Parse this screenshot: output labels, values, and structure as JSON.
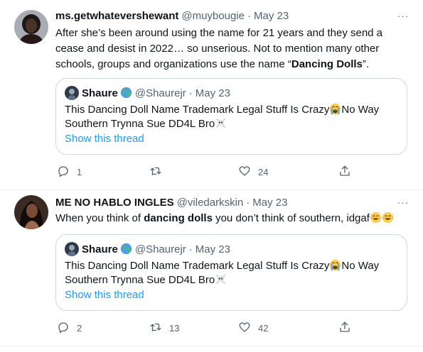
{
  "tweets": [
    {
      "name": "ms.getwhatevershewant",
      "handle": "@muybougie",
      "separator": "·",
      "date": "May 23",
      "more": "···",
      "text_part1": "After she’s been around using the name for 21 years and they send a cease and desist in 2022… so unserious. Not to mention many other schools, groups and organizations use the name “",
      "text_bold": "Dancing Dolls",
      "text_part2": "”.",
      "quote": {
        "name": "Shaure",
        "handle": "@Shaurejr",
        "separator": "·",
        "date": "May 23",
        "line1": "This Dancing Doll Name Trademark Legal Stuff Is Crazy",
        "line1_after": "No Way",
        "line2": "Southern Trynna Sue DD4L Bro",
        "link": "Show this thread"
      },
      "actions": {
        "reply": "1",
        "retweet": "",
        "like": "24"
      }
    },
    {
      "name": "ME NO HABLO INGLES",
      "handle": "@viledarkskin",
      "separator": "·",
      "date": "May 23",
      "more": "···",
      "text_part1": "When you think of ",
      "text_bold": "dancing dolls",
      "text_part2": " you don’t think of southern, idgaf",
      "quote": {
        "name": "Shaure",
        "handle": "@Shaurejr",
        "separator": "·",
        "date": "May 23",
        "line1": "This Dancing Doll Name Trademark Legal Stuff Is Crazy",
        "line1_after": "No Way",
        "line2": "Southern Trynna Sue DD4L Bro",
        "link": "Show this thread"
      },
      "actions": {
        "reply": "2",
        "retweet": "13",
        "like": "42"
      }
    }
  ],
  "colors": {
    "accent": "#1d9bf0",
    "secondary_text": "#536471",
    "border": "#cfd9de"
  },
  "icons": [
    "reply-icon",
    "retweet-icon",
    "like-icon",
    "share-icon",
    "crying-face-emoji",
    "skull-crossbones-emoji",
    "tears-of-joy-emoji",
    "earth-globe-emoji"
  ]
}
